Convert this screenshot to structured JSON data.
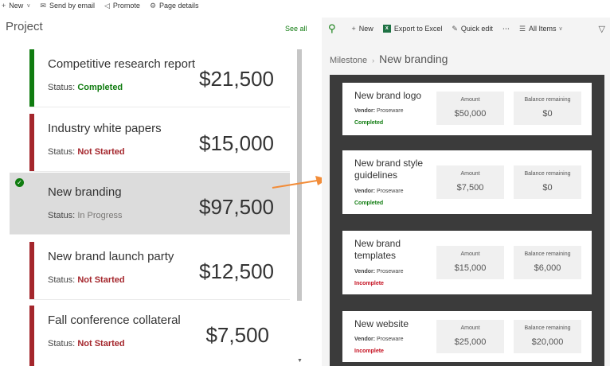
{
  "toolbar": {
    "items": [
      {
        "label": "New",
        "icon": "plus-icon"
      },
      {
        "label": "Send by email",
        "icon": "mail-icon"
      },
      {
        "label": "Promote",
        "icon": "megaphone-icon"
      },
      {
        "label": "Page details",
        "icon": "gear-icon"
      }
    ]
  },
  "left": {
    "title": "Project",
    "see_all": "See all",
    "status_prefix": "Status:",
    "projects": [
      {
        "name": "Competitive research report",
        "status": "Completed",
        "amount": "$21,500",
        "color": "#107c10"
      },
      {
        "name": "Industry white papers",
        "status": "Not Started",
        "amount": "$15,000",
        "color": "#a4262c"
      },
      {
        "name": "New branding",
        "status": "In Progress",
        "amount": "$97,500",
        "color": "#797775",
        "selected": true
      },
      {
        "name": "New brand launch party",
        "status": "Not Started",
        "amount": "$12,500",
        "color": "#a4262c"
      },
      {
        "name": "Fall conference collateral",
        "status": "Not Started",
        "amount": "$7,500",
        "color": "#a4262c"
      }
    ]
  },
  "right": {
    "commands": {
      "new": "New",
      "export": "Export to Excel",
      "quick_edit": "Quick edit",
      "more": "⋯",
      "view": "All Items"
    },
    "breadcrumb": {
      "parent": "Milestone",
      "current": "New branding"
    },
    "labels": {
      "vendor": "Vendor:",
      "amount": "Amount",
      "balance": "Balance remaining"
    },
    "milestones": [
      {
        "title": "New brand logo",
        "vendor": "Proseware",
        "status": "Completed",
        "amount": "$50,000",
        "balance": "$0",
        "status_color": "#107c10"
      },
      {
        "title": "New brand style guidelines",
        "vendor": "Proseware",
        "status": "Completed",
        "amount": "$7,500",
        "balance": "$0",
        "status_color": "#107c10"
      },
      {
        "title": "New brand templates",
        "vendor": "Proseware",
        "status": "Incomplete",
        "amount": "$15,000",
        "balance": "$6,000",
        "status_color": "#c50f1f"
      },
      {
        "title": "New website",
        "vendor": "Proseware",
        "status": "Incomplete",
        "amount": "$25,000",
        "balance": "$20,000",
        "status_color": "#c50f1f"
      }
    ]
  },
  "colors": {
    "accent": "#107c10",
    "not_started": "#a4262c",
    "arrow": "#f28c38"
  }
}
